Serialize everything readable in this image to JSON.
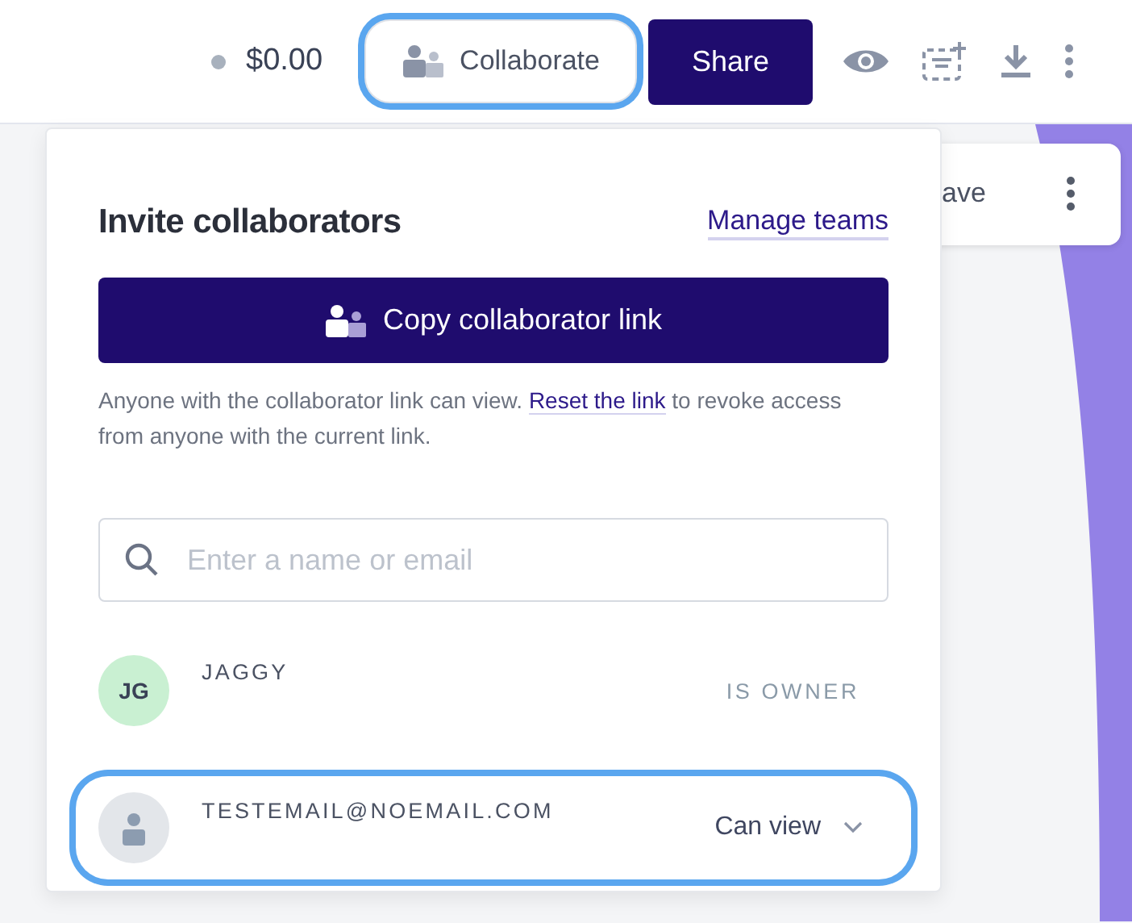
{
  "toolbar": {
    "cost": "$0.00",
    "collaborate": {
      "label": "Collaborate",
      "highlighted": true
    },
    "share": "Share"
  },
  "background_card": {
    "label": "ave"
  },
  "popover": {
    "title": "Invite collaborators",
    "manage_link": "Manage teams",
    "copy_button": "Copy collaborator link",
    "help": {
      "before": "Anyone with the collaborator link can view.",
      "link": "Reset the link",
      "after": "to revoke access from anyone with the current link."
    },
    "search": {
      "placeholder": "Enter a name or email"
    },
    "members": [
      {
        "kind": "initials",
        "initials": "JG",
        "name": "JAGGY",
        "role": "IS OWNER",
        "highlighted": false
      },
      {
        "kind": "guest",
        "name": "TESTEMAIL@NOEMAIL.COM",
        "permission": "Can view",
        "highlighted": true
      }
    ]
  }
}
